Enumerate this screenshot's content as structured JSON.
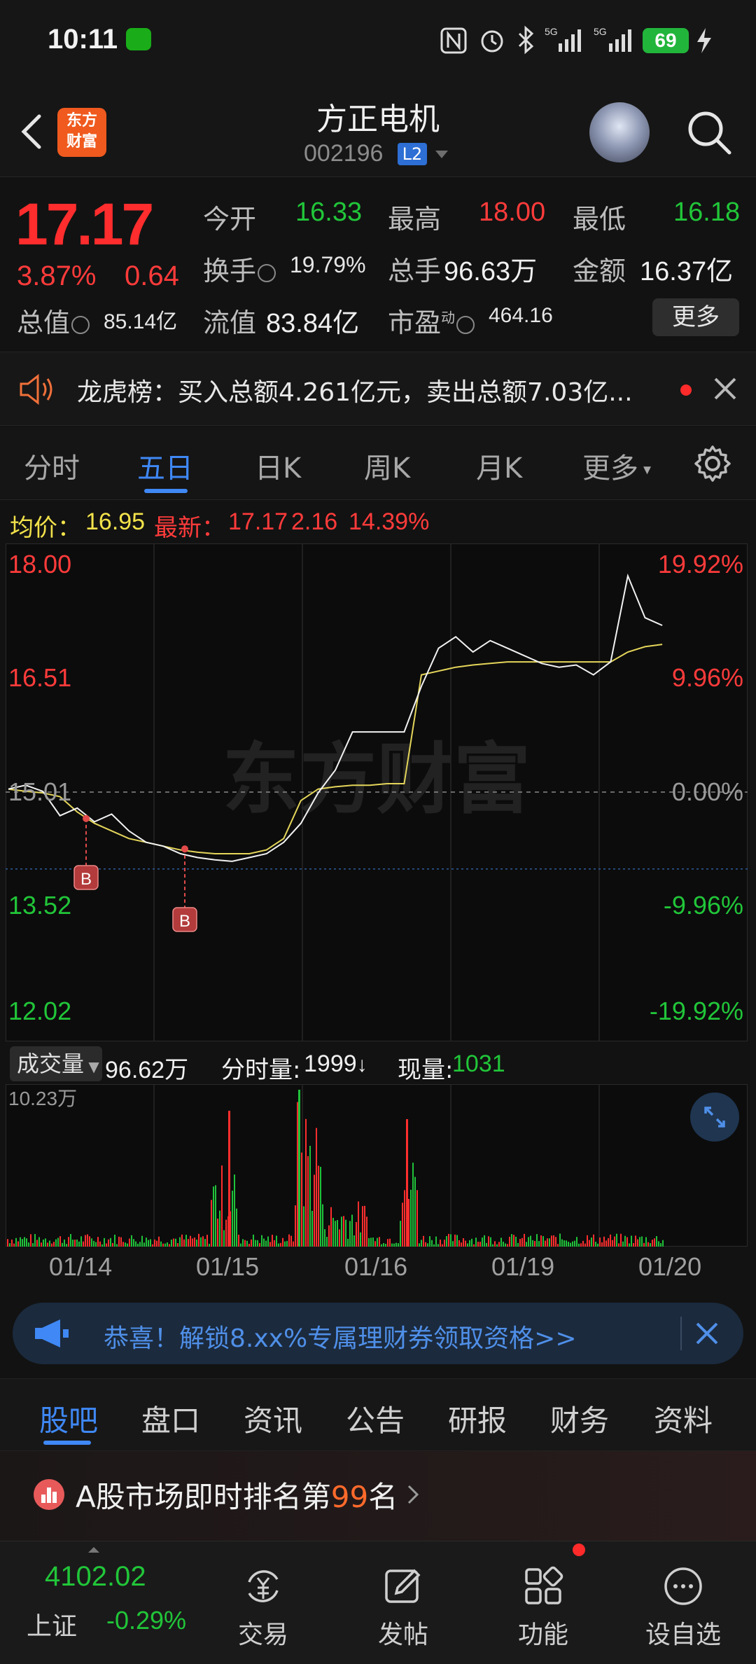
{
  "status_bar": {
    "time": "10:11",
    "battery": "69"
  },
  "header": {
    "title": "方正电机",
    "code": "002196",
    "level_badge": "L2",
    "logo_text_1": "东方",
    "logo_text_2": "财富"
  },
  "quote": {
    "price": "17.17",
    "change_pct": "3.87%",
    "change": "0.64",
    "open_label": "今开",
    "open": "16.33",
    "high_label": "最高",
    "high": "18.00",
    "low_label": "最低",
    "low": "16.18",
    "turnover_label": "换手",
    "turnover": "19.79%",
    "volume_label": "总手",
    "volume": "96.63万",
    "amount_label": "金额",
    "amount": "16.37亿",
    "mktcap_label": "总值",
    "mktcap": "85.14亿",
    "float_label": "流值",
    "float": "83.84亿",
    "pe_label": "市盈",
    "pe_sup": "动",
    "pe": "464.16",
    "more": "更多"
  },
  "dragon_tiger": {
    "text": "龙虎榜：买入总额4.261亿元，卖出总额7.03亿..."
  },
  "period_tabs": [
    "分时",
    "五日",
    "日K",
    "周K",
    "月K",
    "更多"
  ],
  "active_period": "五日",
  "info_line": {
    "avg_label": "均价：",
    "avg": "16.95",
    "latest_label": "最新：",
    "latest": "17.17",
    "latest_chg": "2.16",
    "latest_pct": "14.39%"
  },
  "chart_data": {
    "type": "line",
    "days": [
      "01/14",
      "01/15",
      "01/16",
      "01/19",
      "01/20"
    ],
    "y_ticks": [
      "18.00",
      "16.51",
      "15.01",
      "13.52",
      "12.02"
    ],
    "y_pct_ticks": [
      "19.92%",
      "9.96%",
      "0.00%",
      "-9.96%",
      "-19.92%"
    ],
    "ylim": [
      12.02,
      18.0
    ],
    "prev_close": 15.01,
    "buy_markers": [
      "B",
      "B"
    ],
    "watermark": "东方财富",
    "price_series": [
      15.05,
      15.1,
      15.02,
      14.7,
      14.8,
      14.62,
      14.72,
      14.5,
      14.35,
      14.3,
      14.2,
      14.15,
      14.12,
      14.1,
      14.15,
      14.2,
      14.35,
      14.6,
      15.0,
      15.3,
      15.8,
      15.8,
      15.8,
      15.8,
      16.4,
      16.9,
      17.05,
      16.85,
      17.0,
      16.9,
      16.8,
      16.7,
      16.65,
      16.68,
      16.55,
      16.72,
      17.85,
      17.3,
      17.2
    ],
    "avg_series": [
      15.05,
      15.02,
      15.0,
      14.95,
      14.75,
      14.6,
      14.5,
      14.4,
      14.35,
      14.3,
      14.25,
      14.22,
      14.2,
      14.2,
      14.2,
      14.25,
      14.4,
      14.9,
      15.05,
      15.08,
      15.1,
      15.1,
      15.12,
      15.12,
      16.55,
      16.6,
      16.65,
      16.68,
      16.7,
      16.72,
      16.72,
      16.72,
      16.72,
      16.72,
      16.72,
      16.72,
      16.85,
      16.92,
      16.95
    ]
  },
  "volume_panel": {
    "dropdown": "成交量",
    "total": "96.62万",
    "minute_label": "分时量:",
    "minute": "1999",
    "now_label": "现量:",
    "now": "1031",
    "scale": "10.23万"
  },
  "promo": {
    "text": "恭喜！解锁8.xx%专属理财券领取资格>>"
  },
  "bottom_tabs": [
    "股吧",
    "盘口",
    "资讯",
    "公告",
    "研报",
    "财务",
    "资料"
  ],
  "ranking": {
    "prefix": "A股市场即时排名第",
    "rank": "99",
    "suffix": "名"
  },
  "bottom_nav": {
    "index_value": "4102.02",
    "index_name": "上证",
    "index_pct": "-0.29%",
    "items": [
      "交易",
      "发帖",
      "功能",
      "设自选"
    ]
  }
}
